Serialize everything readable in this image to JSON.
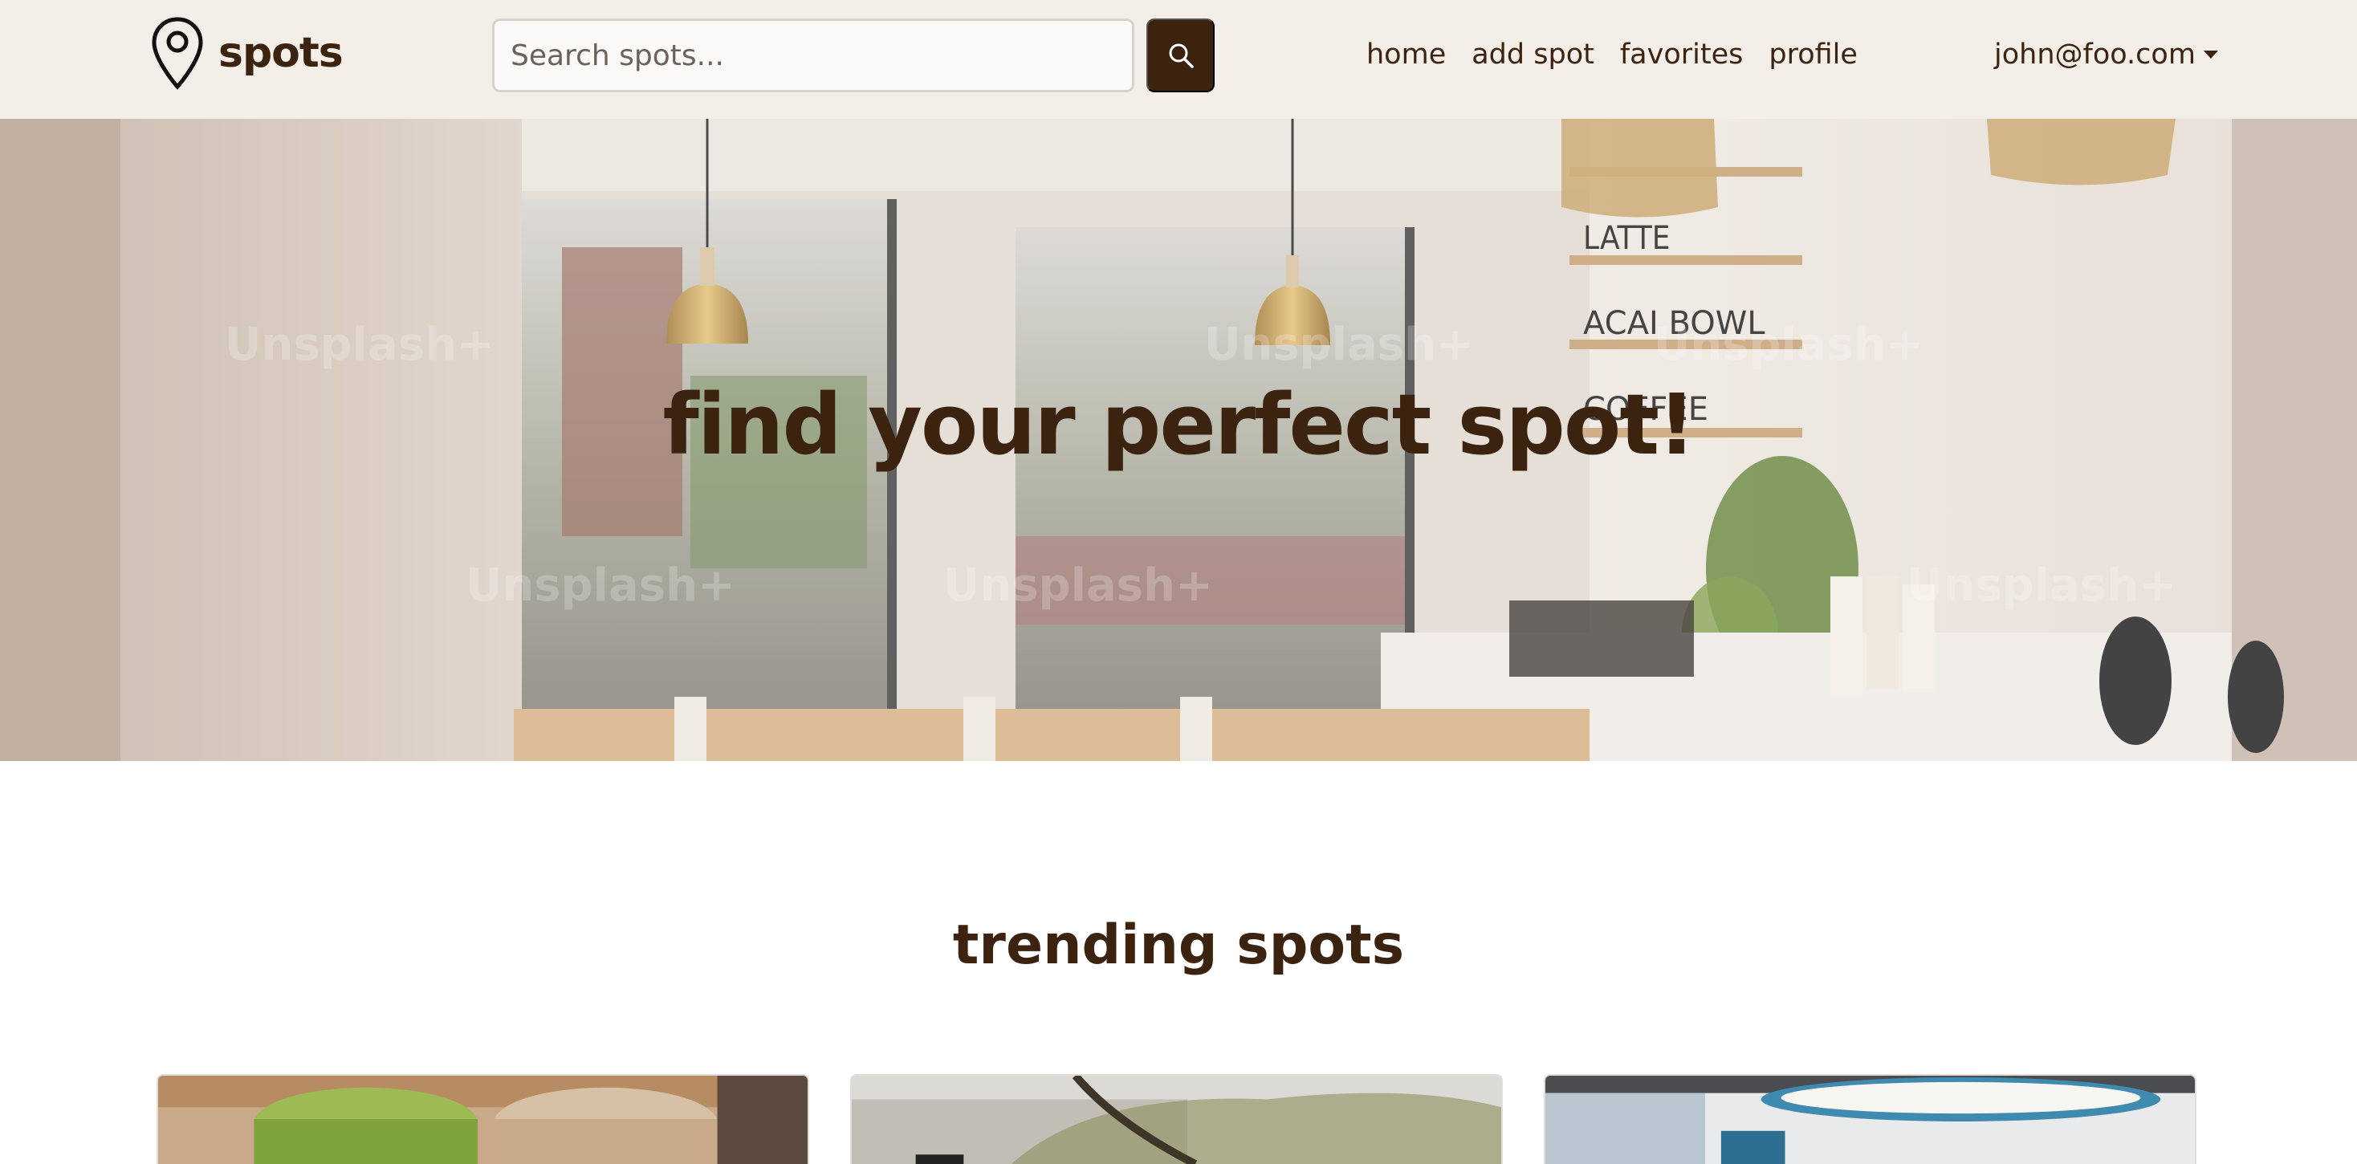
{
  "brand": {
    "name": "spots",
    "icon": "map-pin-icon"
  },
  "search": {
    "placeholder": "Search spots...",
    "value": "",
    "button_icon": "search-icon"
  },
  "nav": {
    "links": [
      {
        "label": "home"
      },
      {
        "label": "add spot"
      },
      {
        "label": "favorites"
      },
      {
        "label": "profile"
      }
    ],
    "user": {
      "email": "john@foo.com",
      "icon": "caret-down-icon"
    }
  },
  "hero": {
    "title": "find your perfect spot!",
    "image_text": {
      "menu": [
        "LATTE",
        "ACAI BOWL",
        "COFFEE"
      ],
      "watermark": "Unsplash+"
    }
  },
  "trending": {
    "title": "trending spots",
    "cards": [
      {
        "image": "iced-drinks-photo"
      },
      {
        "image": "cafe-storefront-photo"
      },
      {
        "image": "office-interior-photo"
      }
    ]
  },
  "colors": {
    "navbar_bg": "#f3eee8",
    "primary": "#3b230f",
    "page_bg": "#ffffff"
  }
}
